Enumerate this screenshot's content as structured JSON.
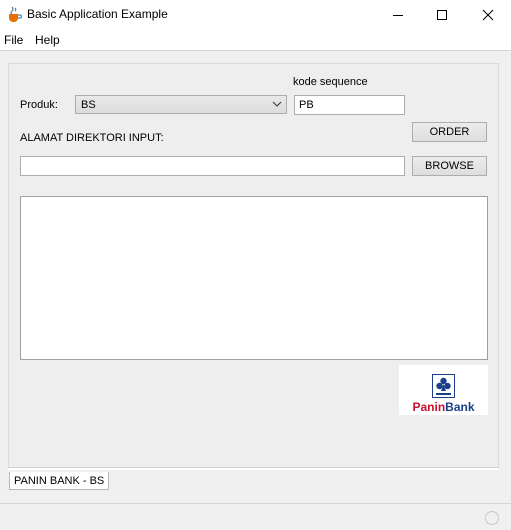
{
  "window": {
    "title": "Basic Application Example",
    "icon": "java-cup-icon",
    "controls": [
      "minimize-icon",
      "maximize-icon",
      "close-icon"
    ]
  },
  "menubar": {
    "file": "File",
    "help": "Help"
  },
  "form": {
    "produk_label": "Produk:",
    "produk_value": "BS",
    "kode_sequence_label": "kode sequence",
    "kode_sequence_value": "PB",
    "alamat_label": "ALAMAT DIREKTORI INPUT:",
    "alamat_value": "",
    "order_button": "ORDER",
    "browse_button": "BROWSE",
    "output_text": ""
  },
  "logo": {
    "text_panin": "Panin",
    "text_bank": "Bank",
    "panin_color": "#c8102e",
    "bank_color": "#1b3f8b"
  },
  "tabs": [
    {
      "label": "PANIN BANK - BS"
    }
  ]
}
